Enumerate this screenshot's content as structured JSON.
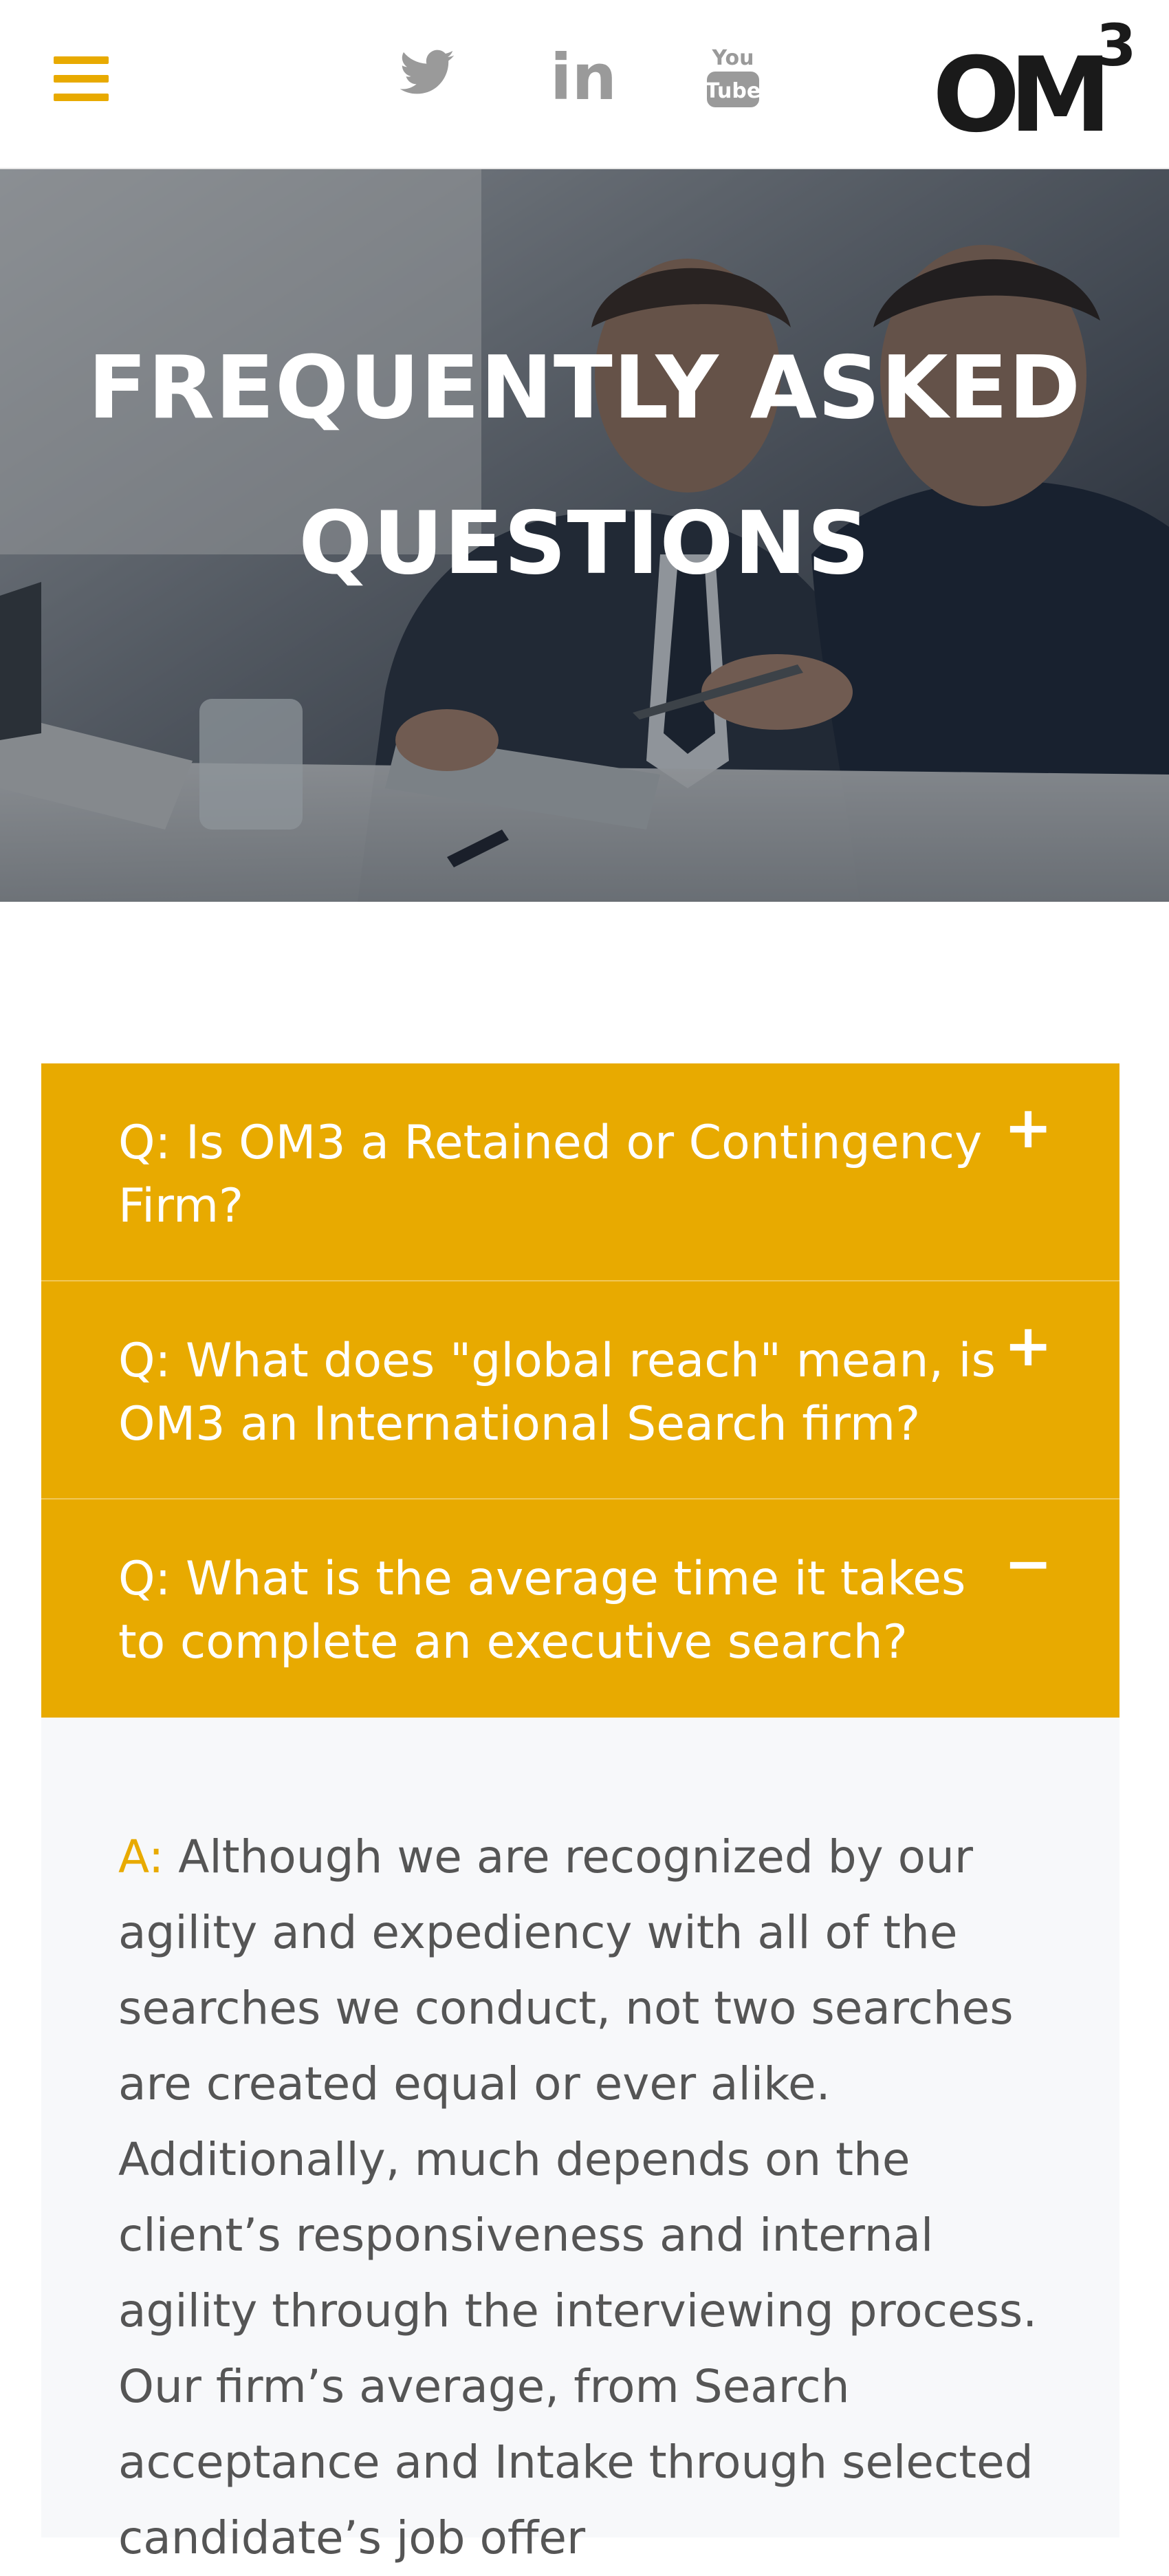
{
  "header": {
    "menu_icon": "hamburger-menu-icon",
    "social": [
      {
        "name": "twitter-icon"
      },
      {
        "name": "linkedin-icon",
        "text": "in"
      },
      {
        "name": "youtube-icon",
        "text_top": "You",
        "text_bottom": "Tube"
      }
    ],
    "logo": {
      "main": "OM",
      "sup": "3"
    }
  },
  "hero": {
    "title_line1": "FREQUENTLY ASKED",
    "title_line2": "QUESTIONS"
  },
  "faq": {
    "accent_color": "#e8aa00",
    "items": [
      {
        "question": "Q: Is OM3 a Retained or Contingency Firm?",
        "toggle": "+",
        "expanded": false
      },
      {
        "question": "Q: What does \"global reach\" mean, is OM3 an International Search firm?",
        "toggle": "+",
        "expanded": false
      },
      {
        "question": "Q: What is the average time it takes to complete an executive search?",
        "toggle": "−",
        "expanded": true
      }
    ],
    "answer": {
      "prefix": "A:",
      "text": " Although we are recognized by our agility and expediency with all of the searches we conduct, not two searches are created equal or ever alike. Additionally, much depends on the client’s responsiveness and internal agility through the interviewing process.  Our firm’s average, from Search acceptance and Intake through selected candidate’s job offer"
    }
  }
}
